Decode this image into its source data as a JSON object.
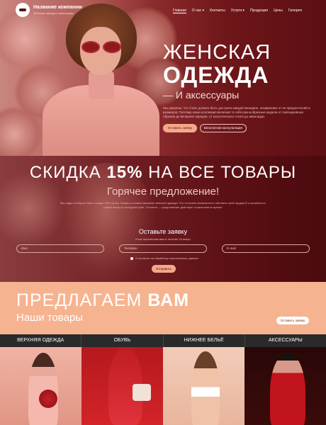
{
  "header": {
    "company_name": "Название компании",
    "company_tagline": "Женская одежда и аксессуары",
    "nav": [
      "Главная",
      "О нас ▾",
      "Контакты",
      "Услуги ▾",
      "Продукция",
      "Цены",
      "Галерея"
    ]
  },
  "hero": {
    "title_line1": "ЖЕНСКАЯ",
    "title_line2": "ОДЕЖДА",
    "subtitle": "— И аксессуары",
    "description": "Мы уверены, что стиль должен быть доступен каждой женщине, независимо от ее предпочтений и размеров. Поэтому наша коллекция включает в себя разнообразные модели от повседневных образов до вечерних нарядов, от классического стиля до авангарда.",
    "primary_button": "Оставить заявку",
    "secondary_button": "Бесплатная консультация"
  },
  "promo": {
    "title_prefix": "СКИДКА ",
    "title_bold": "15%",
    "title_suffix": " НА ВСЕ ТОВАРЫ",
    "subtitle": "Горячее предложение!",
    "description": "Мы рады сообщить вам о скидке 15% на все товары в нашем магазине женской одежды! Это отличная возможность обновить свой гардероб и приобрести новые вещи по выгодной цене. Спешите — предложение действует ограниченное время!",
    "form_title": "Оставьте заявку",
    "form_subtitle": "И мы перезвоним вам в течение 15 минут",
    "fields": {
      "name_placeholder": "Имя",
      "phone_placeholder": "Телефон",
      "email_placeholder": "E-mail"
    },
    "consent_text": "Я согласен на обработку персональных данных",
    "send_button": "Отправить"
  },
  "offer": {
    "title_prefix": "ПРЕДЛАГАЕМ ",
    "title_bold": "ВАМ",
    "subtitle": "Наши товары",
    "button": "Оставить заявку"
  },
  "categories": [
    "ВЕРХНЯЯ ОДЕЖДА",
    "ОБУВЬ",
    "НИЖНЕЕ БЕЛЬЁ",
    "АКСЕССУАРЫ"
  ],
  "colors": {
    "accent": "#f3a98a",
    "offer_bg": "#f6b38f",
    "dark_bg": "#5b0f13"
  }
}
